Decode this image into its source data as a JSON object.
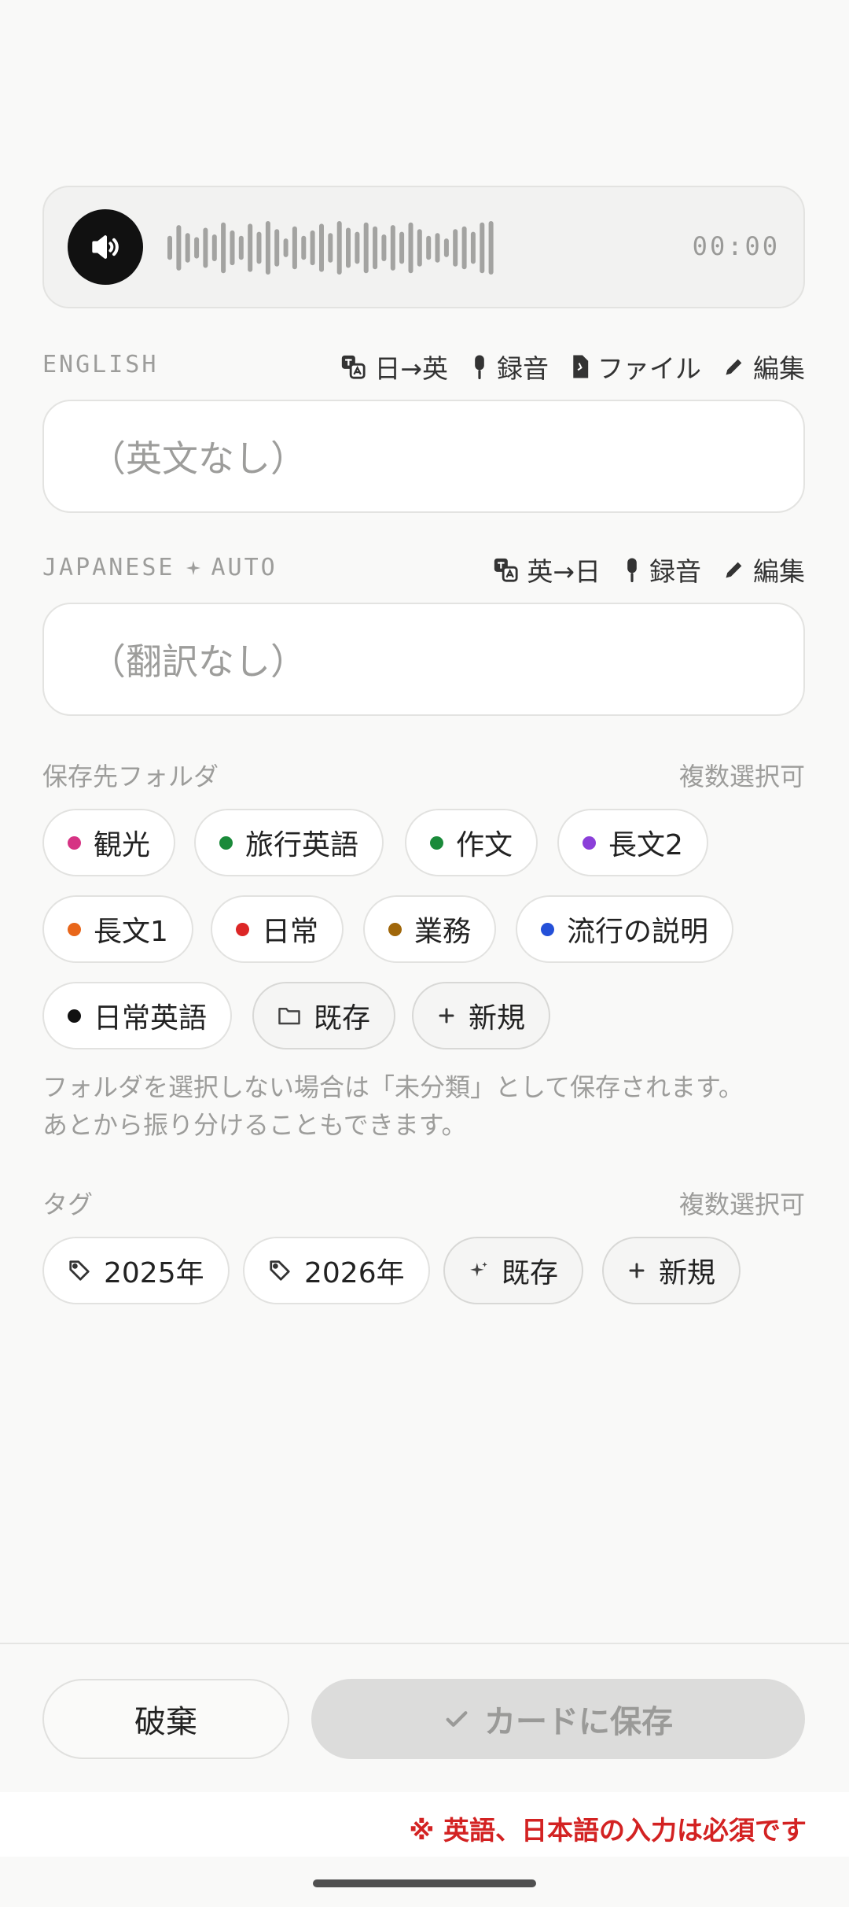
{
  "audio": {
    "time": "00:00",
    "icon": "speaker-icon",
    "waveform": [
      0.45,
      0.85,
      0.55,
      0.4,
      0.75,
      0.5,
      0.95,
      0.65,
      0.45,
      0.9,
      0.6,
      1.0,
      0.7,
      0.35,
      0.8,
      0.45,
      0.65,
      0.9,
      0.55,
      1.0,
      0.75,
      0.6,
      0.95,
      0.8,
      0.5,
      0.85,
      0.6,
      0.95,
      0.7,
      0.45,
      0.55,
      0.35,
      0.7,
      0.8,
      0.6,
      0.95,
      1.0
    ]
  },
  "english": {
    "label": "ENGLISH",
    "actions": {
      "jp_to_en": "日→英",
      "record": "録音",
      "file": "ファイル",
      "edit": "編集"
    },
    "placeholder": "（英文なし）"
  },
  "japanese": {
    "label": "JAPANESE",
    "label_auto": "AUTO",
    "actions": {
      "en_to_jp": "英→日",
      "record": "録音",
      "edit": "編集"
    },
    "placeholder": "（翻訳なし）"
  },
  "folders": {
    "title": "保存先フォルダ",
    "multi": "複数選択可",
    "items": [
      {
        "label": "観光",
        "color": "#d63384"
      },
      {
        "label": "旅行英語",
        "color": "#1a8a3a"
      },
      {
        "label": "作文",
        "color": "#1a8a3a"
      },
      {
        "label": "長文2",
        "color": "#8b3fd9"
      },
      {
        "label": "長文1",
        "color": "#e8661a"
      },
      {
        "label": "日常",
        "color": "#dc2626"
      },
      {
        "label": "業務",
        "color": "#a0670a"
      },
      {
        "label": "流行の説明",
        "color": "#2450d8"
      },
      {
        "label": "日常英語",
        "color": "#111111"
      }
    ],
    "existing": "既存",
    "new": "新規",
    "hint_line1": "フォルダを選択しない場合は「未分類」として保存されます。",
    "hint_line2": "あとから振り分けることもできます。"
  },
  "tags": {
    "title": "タグ",
    "multi": "複数選択可",
    "items": [
      "2025年",
      "2026年"
    ],
    "existing": "既存",
    "new": "新規"
  },
  "footer": {
    "discard": "破棄",
    "save": "カードに保存",
    "warning": "※ 英語、日本語の入力は必須です"
  }
}
